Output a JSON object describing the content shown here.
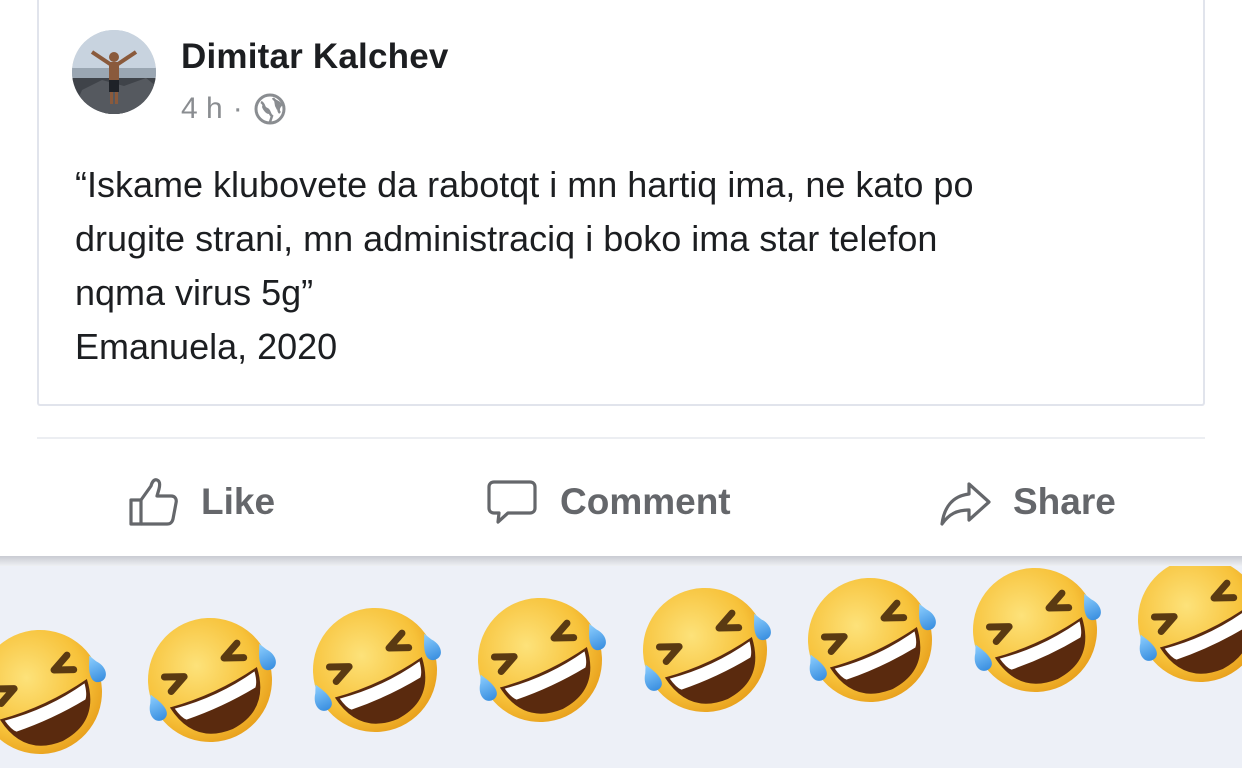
{
  "post": {
    "author": "Dimitar Kalchev",
    "time": "4 h",
    "separator": "·",
    "privacy_icon": "globe-icon",
    "lines": [
      "“Iskame klubovete da rabotqt i mn hartiq ima, ne kato po",
      "drugite strani, mn administraciq i boko ima star telefon",
      "nqma virus 5g”",
      "Emanuela, 2020"
    ]
  },
  "actions": {
    "like_label": "Like",
    "comment_label": "Comment",
    "share_label": "Share"
  },
  "reactions": {
    "icon": "rolling-on-floor-laughing-emoji",
    "count": 8
  },
  "colors": {
    "text": "#1c1e21",
    "muted": "#65676b",
    "emoji_face": "#f7c43a"
  }
}
